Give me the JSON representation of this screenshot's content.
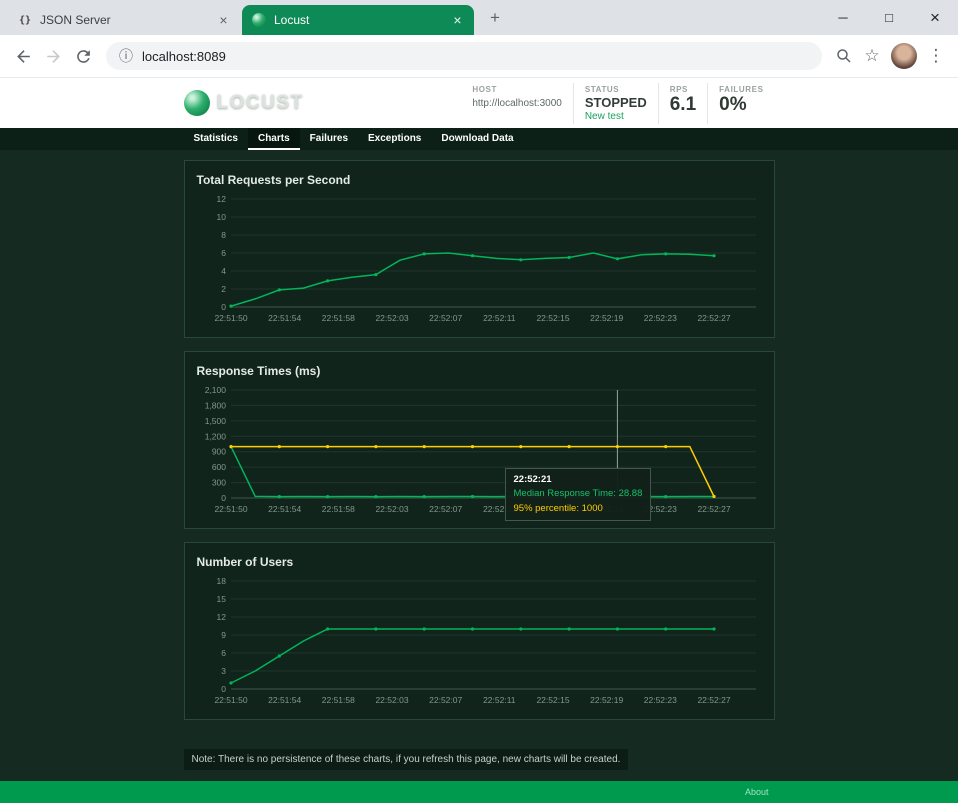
{
  "browser": {
    "tabs": [
      {
        "title": "JSON Server"
      },
      {
        "title": "Locust"
      }
    ],
    "new_tab_label": "+",
    "tab_close_glyph": "×",
    "url": "localhost:8089",
    "info_icon_glyph": "ⓘ",
    "star_icon_glyph": "☆",
    "menu_icon_glyph": "⋮",
    "json_favicon_glyph": "{}",
    "window": {
      "minimize": "─",
      "maximize": "□",
      "close": "×"
    }
  },
  "header": {
    "logo_text": "LOCUST",
    "host_label": "HOST",
    "host_value": "http://localhost:3000",
    "status_label": "STATUS",
    "status_value": "STOPPED",
    "new_test_label": "New test",
    "rps_label": "RPS",
    "rps_value": "6.1",
    "failures_label": "FAILURES",
    "failures_value": "0%"
  },
  "nav": {
    "items": [
      {
        "label": "Statistics"
      },
      {
        "label": "Charts",
        "active": true
      },
      {
        "label": "Failures"
      },
      {
        "label": "Exceptions"
      },
      {
        "label": "Download Data"
      }
    ]
  },
  "charts": [
    {
      "type": "line",
      "title": "Total Requests per Second",
      "categories": [
        "22:51:50",
        "22:51:54",
        "22:51:58",
        "22:52:03",
        "22:52:07",
        "22:52:11",
        "22:52:15",
        "22:52:19",
        "22:52:23",
        "22:52:27"
      ],
      "ylim": [
        0,
        12
      ],
      "yticks": [
        0,
        2,
        4,
        6,
        8,
        10,
        12
      ],
      "series": [
        {
          "name": "RPS",
          "color": "#00b55a",
          "values": [
            0.1,
            0.9,
            1.9,
            2.1,
            2.9,
            3.3,
            3.6,
            5.2,
            5.9,
            6.0,
            5.7,
            5.4,
            5.25,
            5.4,
            5.5,
            6.0,
            5.35,
            5.8,
            5.9,
            5.85,
            5.7
          ]
        }
      ]
    },
    {
      "type": "line",
      "title": "Response Times (ms)",
      "categories": [
        "22:51:50",
        "22:51:54",
        "22:51:58",
        "22:52:03",
        "22:52:07",
        "22:52:11",
        "22:52:15",
        "22:52:19",
        "22:52:23",
        "22:52:27"
      ],
      "ylim": [
        0,
        2100
      ],
      "yticks": [
        0,
        300,
        600,
        900,
        1200,
        1500,
        1800,
        2100
      ],
      "crosshair_frac": 0.8,
      "crosshair_time": "22:52:21",
      "series": [
        {
          "name": "Median Response Time",
          "color": "#00b55a",
          "values": [
            1000,
            32,
            28,
            30,
            28,
            29,
            28,
            30,
            28,
            29,
            30,
            28,
            29,
            28,
            30,
            28,
            29,
            28.88,
            28,
            30,
            29
          ]
        },
        {
          "name": "95% percentile",
          "color": "#ffce00",
          "values": [
            1000,
            1000,
            1000,
            1000,
            1000,
            1000,
            1000,
            1000,
            1000,
            1000,
            1000,
            1000,
            1000,
            1000,
            1000,
            1000,
            1000,
            1000,
            1000,
            1000,
            30
          ]
        }
      ]
    },
    {
      "type": "line",
      "title": "Number of Users",
      "categories": [
        "22:51:50",
        "22:51:54",
        "22:51:58",
        "22:52:03",
        "22:52:07",
        "22:52:11",
        "22:52:15",
        "22:52:19",
        "22:52:23",
        "22:52:27"
      ],
      "ylim": [
        0,
        18
      ],
      "yticks": [
        0,
        3,
        6,
        9,
        12,
        15,
        18
      ],
      "series": [
        {
          "name": "Users",
          "color": "#00b55a",
          "values": [
            1,
            3,
            5.5,
            8,
            10,
            10,
            10,
            10,
            10,
            10,
            10,
            10,
            10,
            10,
            10,
            10,
            10,
            10,
            10,
            10,
            10
          ]
        }
      ]
    }
  ],
  "tooltip": {
    "title": "22:52:21",
    "median": "Median Response Time: 28.88",
    "p95": "95% percentile: 1000"
  },
  "note": "Note: There is no persistence of these charts, if you refresh this page, new charts will be created.",
  "footer": {
    "about": "About"
  },
  "colors": {
    "accent_green": "#0e8a56",
    "line_green": "#00b55a",
    "line_yellow": "#ffce00",
    "footer_green": "#009a4e"
  }
}
